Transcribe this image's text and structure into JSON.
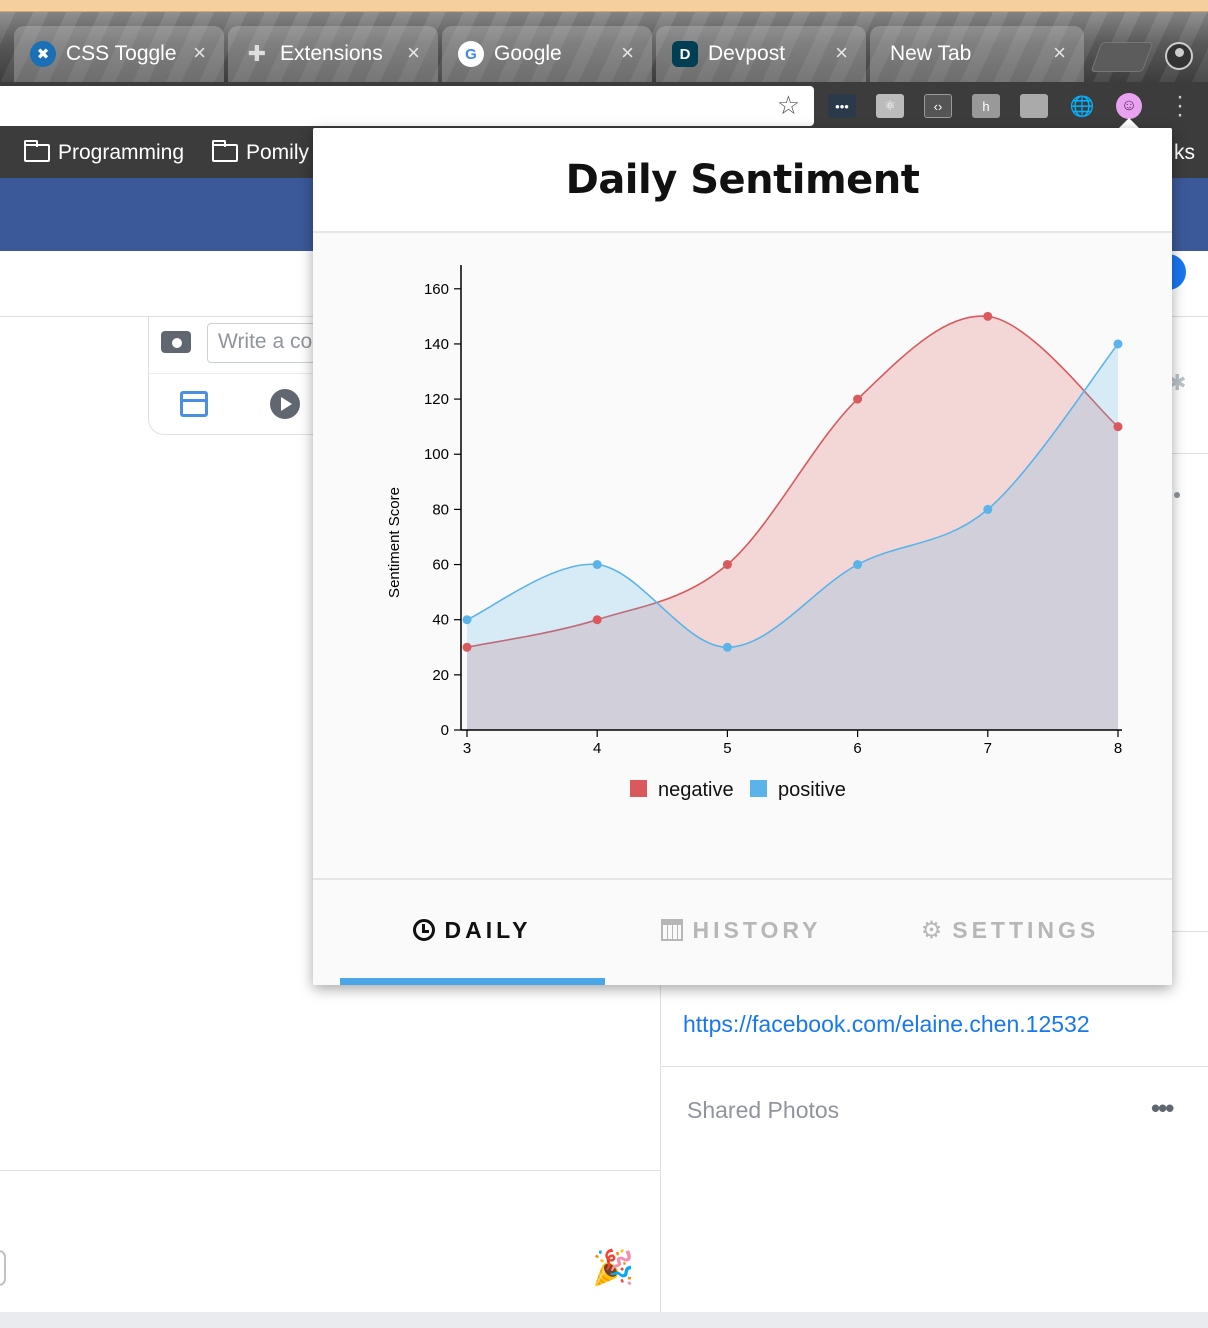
{
  "browser": {
    "tabs": [
      {
        "title": "CSS Toggle",
        "favicon": "css-toggle-icon"
      },
      {
        "title": "Extensions",
        "favicon": "puzzle-icon"
      },
      {
        "title": "Google",
        "favicon": "google-icon"
      },
      {
        "title": "Devpost",
        "favicon": "devpost-icon"
      },
      {
        "title": "New Tab",
        "favicon": ""
      }
    ],
    "close_glyph": "×",
    "bookmarks": [
      {
        "label": "Programming"
      },
      {
        "label": "Pomily"
      },
      {
        "label": "ks"
      }
    ]
  },
  "facebook": {
    "composer_placeholder": "Write a co",
    "profile_link": "https://facebook.com/elaine.chen.12532",
    "shared_photos_label": "Shared Photos",
    "more_label": "•••"
  },
  "popup": {
    "title": "Daily Sentiment",
    "nav": [
      {
        "label": "DAILY",
        "icon": "clock-icon",
        "active": true
      },
      {
        "label": "HISTORY",
        "icon": "calendar-icon",
        "active": false
      },
      {
        "label": "SETTINGS",
        "icon": "gear-icon",
        "active": false
      }
    ]
  },
  "colors": {
    "negative": "#d9595c",
    "positive": "#5ab4ea",
    "active_tab_indicator": "#4aa6e6",
    "facebook_blue": "#3b5998"
  },
  "chart_data": {
    "type": "area",
    "x": [
      3,
      4,
      5,
      6,
      7,
      8
    ],
    "series": [
      {
        "name": "negative",
        "values": [
          30,
          40,
          60,
          120,
          150,
          110
        ],
        "color": "#d9595c"
      },
      {
        "name": "positive",
        "values": [
          40,
          60,
          30,
          60,
          80,
          140
        ],
        "color": "#5ab4ea"
      }
    ],
    "xlabel": "",
    "ylabel": "Sentiment Score",
    "ylim": [
      0,
      165
    ],
    "yticks": [
      0,
      20,
      40,
      60,
      80,
      100,
      120,
      140,
      160
    ],
    "xticks": [
      3,
      4,
      5,
      6,
      7,
      8
    ],
    "legend": "bottom-center",
    "grid": false
  }
}
